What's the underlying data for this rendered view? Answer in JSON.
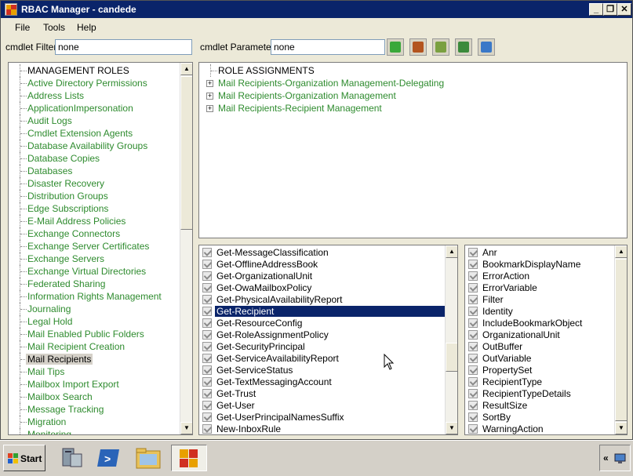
{
  "window": {
    "title": "RBAC Manager - candede"
  },
  "menu": [
    "File",
    "Tools",
    "Help"
  ],
  "filter": {
    "cmdlet_filter_label": "cmdlet Filter",
    "cmdlet_filter_value": "none",
    "cmdlet_parameter_label": "cmdlet Parameter",
    "cmdlet_parameter_value": "none"
  },
  "roles": {
    "header": "MANAGEMENT ROLES",
    "items": [
      "Active Directory Permissions",
      "Address Lists",
      "ApplicationImpersonation",
      "Audit Logs",
      "Cmdlet Extension Agents",
      "Database Availability Groups",
      "Database Copies",
      "Databases",
      "Disaster Recovery",
      "Distribution Groups",
      "Edge Subscriptions",
      "E-Mail Address Policies",
      "Exchange Connectors",
      "Exchange Server Certificates",
      "Exchange Servers",
      "Exchange Virtual Directories",
      "Federated Sharing",
      "Information Rights Management",
      "Journaling",
      "Legal Hold",
      "Mail Enabled Public Folders",
      "Mail Recipient Creation",
      "Mail Recipients",
      "Mail Tips",
      "Mailbox Import Export",
      "Mailbox Search",
      "Message Tracking",
      "Migration",
      "Monitoring"
    ],
    "selected": "Mail Recipients"
  },
  "assignments": {
    "header": "ROLE ASSIGNMENTS",
    "items": [
      "Mail Recipients-Organization Management-Delegating",
      "Mail Recipients-Organization Management",
      "Mail Recipients-Recipient Management"
    ]
  },
  "cmdlets": {
    "items": [
      "Get-MessageClassification",
      "Get-OfflineAddressBook",
      "Get-OrganizationalUnit",
      "Get-OwaMailboxPolicy",
      "Get-PhysicalAvailabilityReport",
      "Get-Recipient",
      "Get-ResourceConfig",
      "Get-RoleAssignmentPolicy",
      "Get-SecurityPrincipal",
      "Get-ServiceAvailabilityReport",
      "Get-ServiceStatus",
      "Get-TextMessagingAccount",
      "Get-Trust",
      "Get-User",
      "Get-UserPrincipalNamesSuffix",
      "New-InboxRule"
    ],
    "selected": "Get-Recipient"
  },
  "parameters": {
    "items": [
      "Anr",
      "BookmarkDisplayName",
      "ErrorAction",
      "ErrorVariable",
      "Filter",
      "Identity",
      "IncludeBookmarkObject",
      "OrganizationalUnit",
      "OutBuffer",
      "OutVariable",
      "PropertySet",
      "RecipientType",
      "RecipientTypeDetails",
      "ResultSize",
      "SortBy",
      "WarningAction"
    ]
  },
  "taskbar": {
    "start_label": "Start",
    "apps": [
      "server-manager-icon",
      "powershell-icon",
      "explorer-folder-icon",
      "rbac-manager-icon"
    ]
  }
}
